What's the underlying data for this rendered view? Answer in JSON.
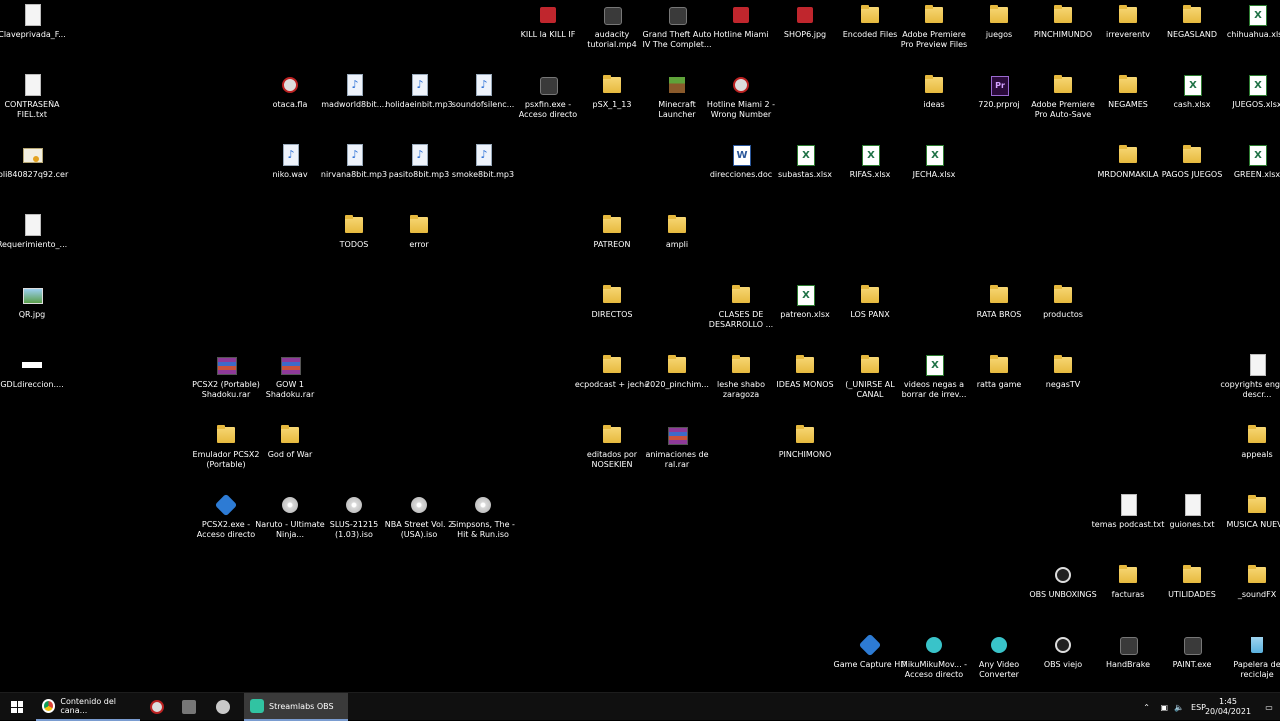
{
  "desktop": {
    "icons": [
      {
        "label": "Claveprivada_F...",
        "kind": "file",
        "icon": "file-icon"
      },
      {
        "label": "CONTRASEÑA FIEL.txt",
        "kind": "file",
        "icon": "text-file-icon"
      },
      {
        "label": "loli840827q92.cer",
        "kind": "cert",
        "icon": "certificate-icon"
      },
      {
        "label": "Requerimiento_...",
        "kind": "file",
        "icon": "file-icon"
      },
      {
        "label": "QR.jpg",
        "kind": "image",
        "icon": "image-icon"
      },
      {
        "label": "GDLdireccion....",
        "kind": "blank",
        "icon": "image-icon"
      },
      {
        "label": "otaca.fla",
        "kind": "circle",
        "icon": "flash-file-icon"
      },
      {
        "label": "niko.wav",
        "kind": "audio",
        "icon": "audio-file-icon"
      },
      {
        "label": "madworld8bit....",
        "kind": "audio",
        "icon": "audio-file-icon"
      },
      {
        "label": "nirvana8bit.mp3",
        "kind": "audio",
        "icon": "audio-file-icon"
      },
      {
        "label": "TODOS",
        "kind": "folder",
        "icon": "folder-icon"
      },
      {
        "label": "holidaeinbit.mp3",
        "kind": "audio",
        "icon": "audio-file-icon"
      },
      {
        "label": "pasito8bit.mp3",
        "kind": "audio",
        "icon": "audio-file-icon"
      },
      {
        "label": "error",
        "kind": "folder",
        "icon": "folder-icon"
      },
      {
        "label": "soundofsilenc...",
        "kind": "audio",
        "icon": "audio-file-icon"
      },
      {
        "label": "smoke8bit.mp3",
        "kind": "audio",
        "icon": "audio-file-icon"
      },
      {
        "label": "PCSX2  (Portable) Shadoku.rar",
        "kind": "rar",
        "icon": "rar-archive-icon"
      },
      {
        "label": "Emulador PCSX2 (Portable)",
        "kind": "folder",
        "icon": "folder-icon"
      },
      {
        "label": "PCSX2.exe - Acceso directo",
        "kind": "blue",
        "icon": "pcsx2-icon"
      },
      {
        "label": "GOW 1 Shadoku.rar",
        "kind": "rar",
        "icon": "rar-archive-icon"
      },
      {
        "label": "God of War",
        "kind": "folder",
        "icon": "folder-icon"
      },
      {
        "label": "Naruto - Ultimate Ninja...",
        "kind": "disc",
        "icon": "disc-image-icon"
      },
      {
        "label": "SLUS-21215 (1.03).iso",
        "kind": "disc",
        "icon": "disc-image-icon"
      },
      {
        "label": "NBA Street Vol. 2 (USA).iso",
        "kind": "disc",
        "icon": "disc-image-icon"
      },
      {
        "label": "Simpsons, The - Hit & Run.iso",
        "kind": "disc",
        "icon": "disc-image-icon"
      },
      {
        "label": "KILL la KILL IF",
        "kind": "red",
        "icon": "game-icon"
      },
      {
        "label": "psxfin.exe - Acceso directo",
        "kind": "app",
        "icon": "emulator-icon"
      },
      {
        "label": "audacity tutorial.mp4",
        "kind": "app",
        "icon": "video-file-icon"
      },
      {
        "label": "pSX_1_13",
        "kind": "folder",
        "icon": "folder-icon"
      },
      {
        "label": "PATREON",
        "kind": "folder",
        "icon": "folder-icon"
      },
      {
        "label": "DIRECTOS",
        "kind": "folder",
        "icon": "folder-icon"
      },
      {
        "label": "ecpodcast + jecha",
        "kind": "folder",
        "icon": "folder-icon"
      },
      {
        "label": "editados por NOSEKIEN",
        "kind": "folder",
        "icon": "folder-icon"
      },
      {
        "label": "Grand Theft Auto IV The Complet...",
        "kind": "app",
        "icon": "gta-icon"
      },
      {
        "label": "Minecraft Launcher",
        "kind": "mc",
        "icon": "minecraft-icon"
      },
      {
        "label": "ampli",
        "kind": "folder",
        "icon": "folder-icon"
      },
      {
        "label": "2020_pinchim...",
        "kind": "folder",
        "icon": "folder-icon"
      },
      {
        "label": "animaciones de ral.rar",
        "kind": "rar",
        "icon": "rar-archive-icon"
      },
      {
        "label": "Hotline Miami",
        "kind": "red",
        "icon": "hotline-miami-icon"
      },
      {
        "label": "Hotline Miami 2 - Wrong Number",
        "kind": "circle",
        "icon": "hotline-miami-2-icon"
      },
      {
        "label": "direcciones.doc",
        "kind": "word",
        "icon": "word-document-icon"
      },
      {
        "label": "CLASES DE DESARROLLO ...",
        "kind": "folder",
        "icon": "folder-icon"
      },
      {
        "label": "leshe shabo zaragoza",
        "kind": "folder",
        "icon": "folder-icon"
      },
      {
        "label": "SHOP6.jpg",
        "kind": "red",
        "icon": "image-icon"
      },
      {
        "label": "subastas.xlsx",
        "kind": "excel",
        "icon": "excel-file-icon"
      },
      {
        "label": "patreon.xlsx",
        "kind": "excel",
        "icon": "excel-file-icon"
      },
      {
        "label": "IDEAS MONOS",
        "kind": "folder",
        "icon": "folder-icon"
      },
      {
        "label": "PINCHIMONO",
        "kind": "folder",
        "icon": "folder-icon"
      },
      {
        "label": "Encoded Files",
        "kind": "folder",
        "icon": "folder-icon"
      },
      {
        "label": "RIFAS.xlsx",
        "kind": "excel",
        "icon": "excel-file-icon"
      },
      {
        "label": "LOS PANX",
        "kind": "folder",
        "icon": "folder-icon"
      },
      {
        "label": "(_UNIRSE AL CANAL",
        "kind": "folder",
        "icon": "folder-icon"
      },
      {
        "label": "Game Capture HD",
        "kind": "blue",
        "icon": "game-capture-icon"
      },
      {
        "label": "Adobe Premiere Pro Preview Files",
        "kind": "folder",
        "icon": "folder-icon"
      },
      {
        "label": "ideas",
        "kind": "folder",
        "icon": "folder-icon"
      },
      {
        "label": "JECHA.xlsx",
        "kind": "excel",
        "icon": "excel-file-icon"
      },
      {
        "label": "videos negas a borrar de irrev...",
        "kind": "excel",
        "icon": "excel-file-icon"
      },
      {
        "label": "MikuMikuMov... - Acceso directo",
        "kind": "cyan",
        "icon": "mikumiku-icon"
      },
      {
        "label": "juegos",
        "kind": "folder",
        "icon": "folder-icon"
      },
      {
        "label": "720.prproj",
        "kind": "premiere",
        "icon": "premiere-project-icon"
      },
      {
        "label": "RATA BROS",
        "kind": "folder",
        "icon": "folder-icon"
      },
      {
        "label": "ratta game",
        "kind": "folder",
        "icon": "folder-icon"
      },
      {
        "label": "Any Video Converter",
        "kind": "cyan",
        "icon": "video-converter-icon"
      },
      {
        "label": "PINCHIMUNDO",
        "kind": "folder",
        "icon": "folder-icon"
      },
      {
        "label": "Adobe Premiere Pro Auto-Save",
        "kind": "folder",
        "icon": "folder-icon"
      },
      {
        "label": "productos",
        "kind": "folder",
        "icon": "folder-icon"
      },
      {
        "label": "negasTV",
        "kind": "folder",
        "icon": "folder-icon"
      },
      {
        "label": "OBS UNBOXINGS",
        "kind": "obs",
        "icon": "obs-icon"
      },
      {
        "label": "OBS viejo",
        "kind": "obs",
        "icon": "obs-icon"
      },
      {
        "label": "irreverentv",
        "kind": "folder",
        "icon": "folder-icon"
      },
      {
        "label": "NEGAMES",
        "kind": "folder",
        "icon": "folder-icon"
      },
      {
        "label": "MRDONMAKILA",
        "kind": "folder",
        "icon": "folder-icon"
      },
      {
        "label": "temas podcast.txt",
        "kind": "file",
        "icon": "text-file-icon"
      },
      {
        "label": "facturas",
        "kind": "folder",
        "icon": "folder-icon"
      },
      {
        "label": "HandBrake",
        "kind": "app",
        "icon": "handbrake-icon"
      },
      {
        "label": "NEGASLAND",
        "kind": "folder",
        "icon": "folder-icon"
      },
      {
        "label": "cash.xlsx",
        "kind": "excel",
        "icon": "excel-file-icon"
      },
      {
        "label": "PAGOS JUEGOS",
        "kind": "folder",
        "icon": "folder-icon"
      },
      {
        "label": "guiones.txt",
        "kind": "file",
        "icon": "text-file-icon"
      },
      {
        "label": "UTILIDADES",
        "kind": "folder",
        "icon": "folder-icon"
      },
      {
        "label": "PAINT.exe",
        "kind": "app",
        "icon": "paint-icon"
      },
      {
        "label": "chihuahua.xlsx",
        "kind": "excel",
        "icon": "excel-file-icon"
      },
      {
        "label": "JUEGOS.xlsx",
        "kind": "excel",
        "icon": "excel-file-icon"
      },
      {
        "label": "GREEN.xlsx",
        "kind": "excel",
        "icon": "excel-file-icon"
      },
      {
        "label": "copyrights english descr...",
        "kind": "file",
        "icon": "text-file-icon"
      },
      {
        "label": "appeals",
        "kind": "folder",
        "icon": "folder-icon"
      },
      {
        "label": "MUSICA NUEVA",
        "kind": "folder",
        "icon": "folder-icon"
      },
      {
        "label": "_soundFX",
        "kind": "folder",
        "icon": "folder-icon"
      },
      {
        "label": "Papelera de reciclaje",
        "kind": "trash",
        "icon": "recycle-bin-icon"
      }
    ]
  },
  "taskbar": {
    "chrome_label": "Contenido del cana...",
    "streamlabs_label": "Streamlabs OBS",
    "language": "ESP",
    "time": "1:45",
    "date": "20/04/2021",
    "accent": "#7a9cd0"
  }
}
